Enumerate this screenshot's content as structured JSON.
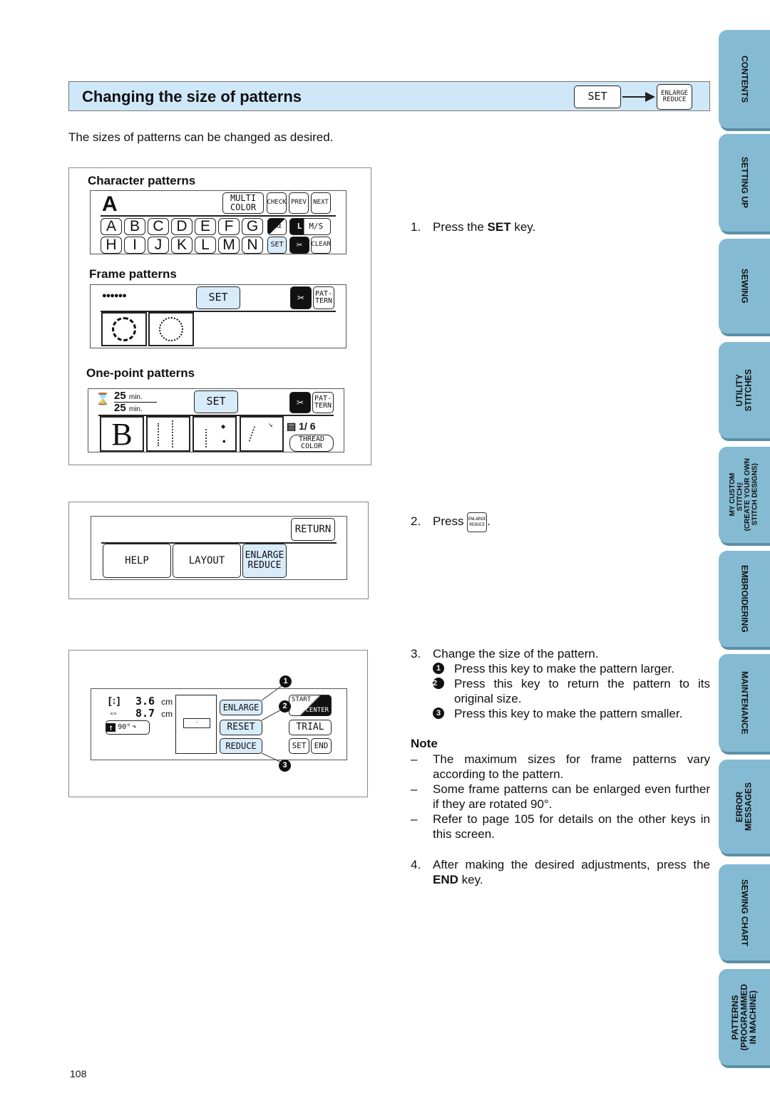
{
  "header": {
    "title": "Changing the size of patterns",
    "set_key": "SET",
    "enlarge_key_line1": "ENLARGE",
    "enlarge_key_line2": "REDUCE"
  },
  "intro": "The sizes of patterns can be changed as desired.",
  "figure1": {
    "character": {
      "heading": "Character patterns",
      "current_char": "A",
      "multi_color_line1": "MULTI",
      "multi_color_line2": "COLOR",
      "check": "CHECK",
      "prev": "PREV",
      "next": "NEXT",
      "row1": [
        "A",
        "B",
        "C",
        "D",
        "E",
        "F",
        "G"
      ],
      "row2": [
        "H",
        "I",
        "J",
        "K",
        "L",
        "M",
        "N"
      ],
      "case_key": "Aα",
      "size_key": "L M/S",
      "set": "SET",
      "clear": "CLEAR"
    },
    "frame": {
      "heading": "Frame patterns",
      "stitch_preview": "●●●●●●",
      "set": "SET",
      "pattern_line1": "PAT-",
      "pattern_line2": "TERN"
    },
    "onepoint": {
      "heading": "One-point patterns",
      "time_total": "25",
      "time_remaining": "25",
      "time_unit": "min.",
      "set": "SET",
      "pattern_line1": "PAT-",
      "pattern_line2": "TERN",
      "letter": "B",
      "thread_count": "1/ 6",
      "thread_color_line1": "THREAD",
      "thread_color_line2": "COLOR"
    }
  },
  "figure2": {
    "return": "RETURN",
    "help": "HELP",
    "layout": "LAYOUT",
    "enlarge_line1": "ENLARGE",
    "enlarge_line2": "REDUCE"
  },
  "figure3": {
    "height_value": "3.6",
    "width_value": "8.7",
    "unit": "cm",
    "rotate_label": "90°",
    "enlarge": "ENLARGE",
    "reset": "RESET",
    "reduce": "REDUCE",
    "start": "START",
    "center": "CENTER",
    "trial": "TRIAL",
    "set": "SET",
    "end": "END",
    "callouts": [
      "1",
      "2",
      "3"
    ]
  },
  "steps": {
    "step1": {
      "num": "1.",
      "pre": "Press the ",
      "bold": "SET",
      "post": " key."
    },
    "step2": {
      "num": "2.",
      "text": "Press",
      "key_line1": "ENLARGE",
      "key_line2": "REDUCE",
      "post": "."
    },
    "step3": {
      "num": "3.",
      "text": "Change the size of the pattern.",
      "items": [
        {
          "marker": "1",
          "text": "Press this key to make the pattern larger."
        },
        {
          "marker": "2",
          "text": "Press this key to return the pattern to its original size."
        },
        {
          "marker": "3",
          "text": "Press this key to make the pattern smaller."
        }
      ]
    },
    "step4": {
      "num": "4.",
      "pre": "After making the desired adjustments, press the ",
      "bold": "END",
      "post": " key."
    }
  },
  "note": {
    "title": "Note",
    "items": [
      "The maximum sizes for frame patterns vary according to the pattern.",
      "Some frame patterns can be enlarged even further if they are rotated 90°.",
      "Refer to page 105 for details on the other keys in this screen."
    ]
  },
  "side_tabs": [
    "CONTENTS",
    "SETTING UP",
    "SEWING",
    "UTILITY\nSTITCHES",
    "MY CUSTOM\nSTITCH™\n(CREATE YOUR OWN\nSTITCH DESIGNS)",
    "EMBROIDERING",
    "MAINTENANCE",
    "ERROR\nMESSAGES",
    "SEWING CHART",
    "PATTERNS\n(PROGRAMMED\nIN MACHINE)"
  ],
  "page_number": "108"
}
